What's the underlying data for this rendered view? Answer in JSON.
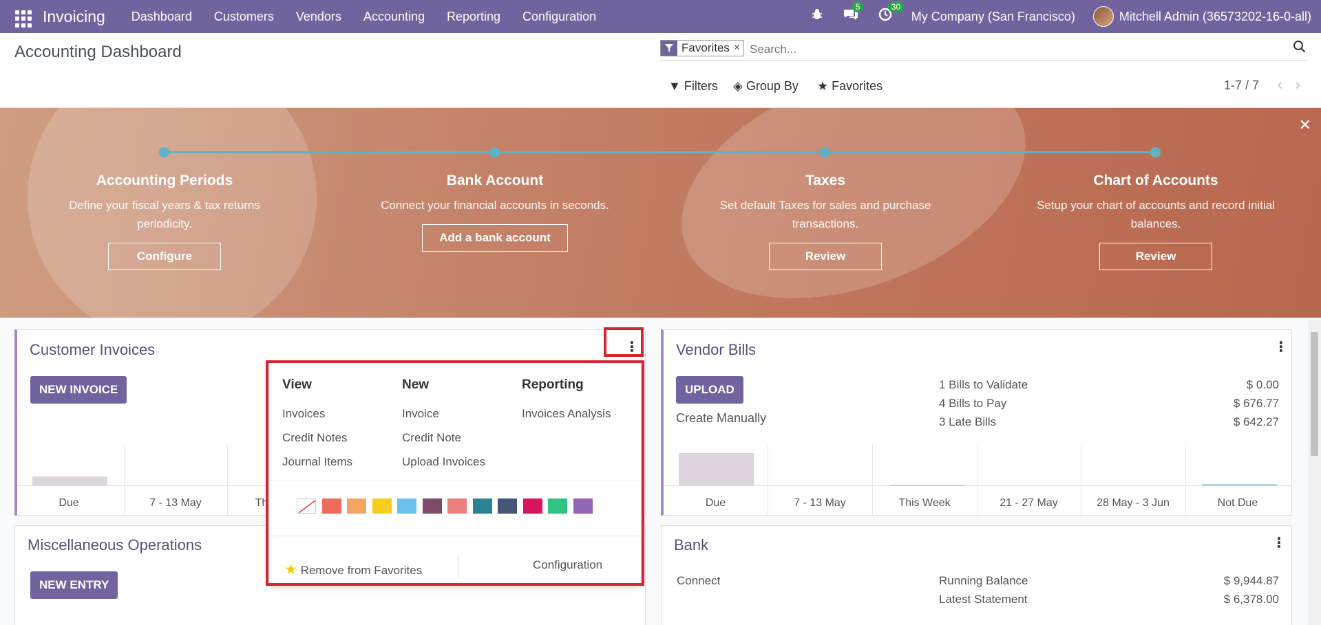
{
  "navbar": {
    "app_name": "Invoicing",
    "menu": [
      "Dashboard",
      "Customers",
      "Vendors",
      "Accounting",
      "Reporting",
      "Configuration"
    ],
    "messages_count": "5",
    "activities_count": "30",
    "company": "My Company (San Francisco)",
    "user": "Mitchell Admin (36573202-16-0-all)"
  },
  "control": {
    "title": "Accounting Dashboard",
    "facet": "Favorites",
    "search_placeholder": "Search...",
    "filters": "Filters",
    "group_by": "Group By",
    "favorites": "Favorites",
    "pager": "1-7 / 7"
  },
  "onboarding": {
    "steps": [
      {
        "title": "Accounting Periods",
        "desc": "Define your fiscal years & tax returns periodicity.",
        "button": "Configure"
      },
      {
        "title": "Bank Account",
        "desc": "Connect your financial accounts in seconds.",
        "button": "Add a bank account"
      },
      {
        "title": "Taxes",
        "desc": "Set default Taxes for sales and purchase transactions.",
        "button": "Review"
      },
      {
        "title": "Chart of Accounts",
        "desc": "Setup your chart of accounts and record initial balances.",
        "button": "Review"
      }
    ]
  },
  "customer_invoices": {
    "title": "Customer Invoices",
    "button": "NEW INVOICE",
    "labels": [
      "Due",
      "7 - 13 May",
      "Th"
    ]
  },
  "vendor_bills": {
    "title": "Vendor Bills",
    "button": "UPLOAD",
    "create_manually": "Create Manually",
    "stats": [
      {
        "label": "1 Bills to Validate",
        "value": "$ 0.00"
      },
      {
        "label": "4 Bills to Pay",
        "value": "$ 676.77"
      },
      {
        "label": "3 Late Bills",
        "value": "$ 642.27"
      }
    ],
    "labels": [
      "Due",
      "7 - 13 May",
      "This Week",
      "21 - 27 May",
      "28 May - 3 Jun",
      "Not Due"
    ]
  },
  "misc": {
    "title": "Miscellaneous Operations",
    "button": "NEW ENTRY"
  },
  "bank": {
    "title": "Bank",
    "connect": "Connect",
    "running_balance_label": "Running Balance",
    "running_balance": "$ 9,944.87",
    "latest_statement_label": "Latest Statement",
    "latest_statement": "$ 6,378.00"
  },
  "dropdown": {
    "view_title": "View",
    "view_items": [
      "Invoices",
      "Credit Notes",
      "Journal Items"
    ],
    "new_title": "New",
    "new_items": [
      "Invoice",
      "Credit Note",
      "Upload Invoices"
    ],
    "reporting_title": "Reporting",
    "reporting_items": [
      "Invoices Analysis"
    ],
    "swatch_colors": [
      "#ffffff",
      "#ee6b5b",
      "#f4a460",
      "#f7cd1f",
      "#6cc1ed",
      "#814968",
      "#eb7e7f",
      "#2c8397",
      "#475577",
      "#d6145f",
      "#30c381",
      "#9365b8"
    ],
    "remove_favorites": "Remove from Favorites",
    "configuration": "Configuration"
  }
}
